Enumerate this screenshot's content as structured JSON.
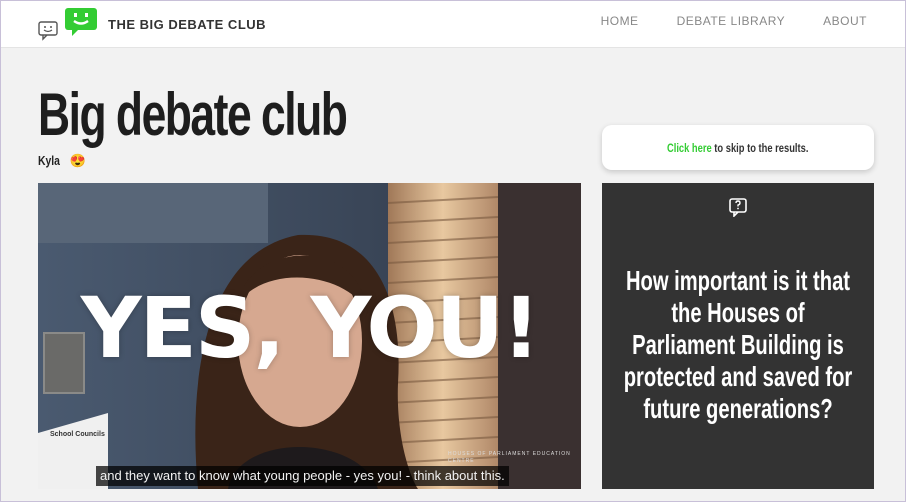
{
  "header": {
    "site_title": "THE BIG DEBATE CLUB",
    "nav": [
      "HOME",
      "DEBATE LIBRARY",
      "ABOUT"
    ],
    "logo_color": "#33cc33"
  },
  "page": {
    "title": "Big debate club",
    "author": "Kyla",
    "author_emoji": "😍"
  },
  "skip": {
    "link_text": "Click here",
    "rest_text": " to skip to the results.",
    "link_color": "#33cc33"
  },
  "video": {
    "overlay_text": "YES, YOU!",
    "subtitle": "and they want to know what young people - yes you! - think about this.",
    "corner_logo_text": "School Councils",
    "watermark": "HOUSES OF PARLIAMENT EDUCATION CENTRE"
  },
  "question": {
    "icon": "question-box-icon",
    "text": "How important is it that the Houses of Parliament Building is protected and saved for future generations?"
  }
}
